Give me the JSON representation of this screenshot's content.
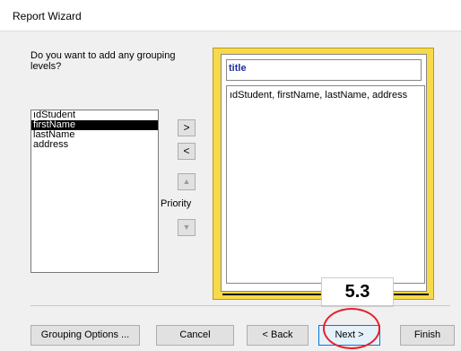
{
  "window": {
    "title": "Report Wizard"
  },
  "grouping": {
    "question": "Do you want to add any grouping levels?",
    "fields": [
      "ıdStudent",
      "firstName",
      "lastName",
      "address"
    ],
    "selected_index": 1,
    "add_label": ">",
    "remove_label": "<",
    "priority_up_label": "▲",
    "priority_down_label": "▼",
    "priority_label": "Priority"
  },
  "preview": {
    "title_placeholder": "title",
    "fields_text": "ıdStudent, firstName, lastName, address",
    "frame_color": "#f8d94a"
  },
  "annotation": {
    "step_label": "5.3",
    "circle_color": "#e5212c"
  },
  "buttons": {
    "grouping_options": "Grouping Options ...",
    "cancel": "Cancel",
    "back": "< Back",
    "next": "Next >",
    "finish": "Finish"
  }
}
